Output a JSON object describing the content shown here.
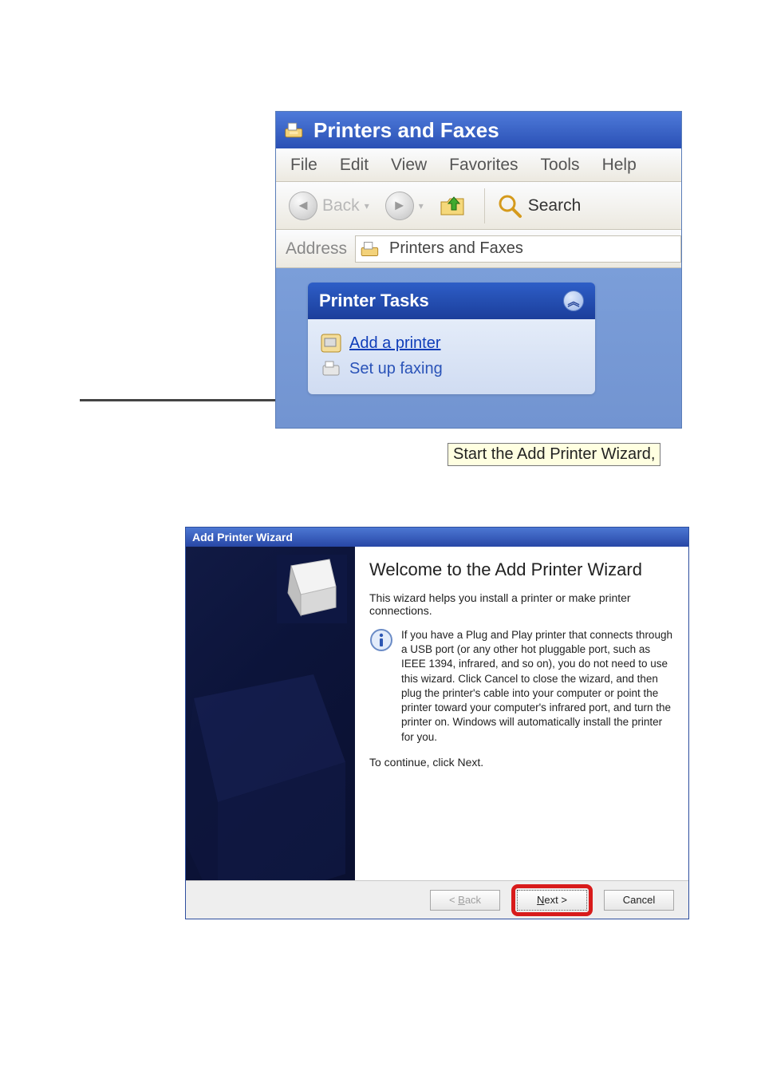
{
  "explorer": {
    "title": "Printers and Faxes",
    "menu": [
      "File",
      "Edit",
      "View",
      "Favorites",
      "Tools",
      "Help"
    ],
    "toolbar": {
      "back": "Back",
      "search": "Search"
    },
    "address_label": "Address",
    "address_value": "Printers and Faxes",
    "tasks": {
      "header": "Printer Tasks",
      "add_printer": "Add a printer",
      "setup_faxing": "Set up faxing"
    },
    "tooltip": "Start the Add Printer Wizard,"
  },
  "wizard": {
    "title": "Add Printer Wizard",
    "heading": "Welcome to the Add Printer Wizard",
    "intro": "This wizard helps you install a printer or make printer connections.",
    "info": "If you have a Plug and Play printer that connects through a USB port (or any other hot pluggable port, such as IEEE 1394, infrared, and so on), you do not need to use this wizard. Click Cancel to close the wizard, and then plug the printer's cable into your computer or point the printer toward your computer's infrared port, and turn the printer on. Windows will automatically install the printer for you.",
    "continue": "To continue, click Next.",
    "buttons": {
      "back": "< Back",
      "next": "Next >",
      "cancel": "Cancel"
    }
  }
}
